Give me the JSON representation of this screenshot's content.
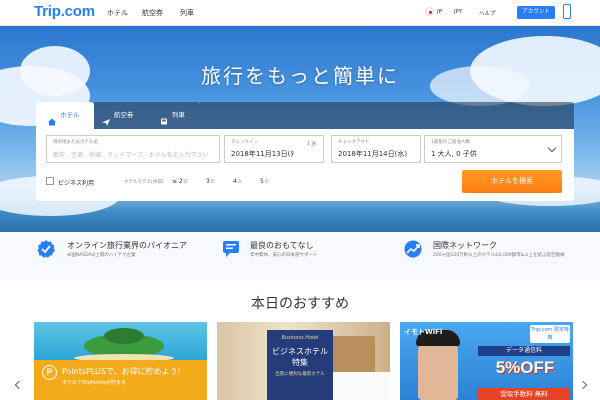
{
  "header": {
    "logo": "Trip.com",
    "nav": [
      "ホテル",
      "航空券",
      "列車"
    ],
    "lang": "JP",
    "currency": "JPY",
    "help": "ヘルプ",
    "account_button": "アカウント"
  },
  "hero": {
    "headline": "旅行をもっと簡単に"
  },
  "search": {
    "tabs": [
      "ホテル",
      "航空券",
      "列車"
    ],
    "destination": {
      "label": "目的地またはホテル名",
      "placeholder": "都市、空港、地域、ランドマーク、ホテル名を入力下さい"
    },
    "checkin": {
      "label": "チェックイン",
      "value": "2018年11月13日(ﾀ"
    },
    "nights": "1 泊",
    "checkout": {
      "label": "チェックアウト",
      "value": "2018年11月14日(水)"
    },
    "guests": {
      "label": "1部屋のご宿泊人数",
      "value": "1 大人, 0 子供"
    },
    "business_label": "ビジネス利用",
    "stars_label": "ホテルクラス(評価)",
    "star_options": [
      "≤ 2☆",
      "3☆",
      "4☆",
      "5☆"
    ],
    "search_button": "ホテルを検索"
  },
  "features": [
    {
      "icon": "badge-check-icon",
      "title": "オンライン旅行業界のパイオニア",
      "desc": "米国NASDAQ上場のハイテク企業"
    },
    {
      "icon": "chat-icon",
      "title": "最良のおもてなし",
      "desc": "年中無休、安心の日本語サポート"
    },
    {
      "icon": "growth-chart-icon",
      "title": "国際ネットワーク",
      "desc": "200ヶ国120万軒以上のホテル&5,000都市&以上を結ぶ航空路線"
    }
  ],
  "recommend": {
    "title": "本日のおすすめ",
    "cards": [
      {
        "title": "PointsPLUSで、お得に貯めよう!",
        "sub": "ホテルでTripPointsが貯まる"
      },
      {
        "title": "ビジネスホテル特集",
        "tag": "Business Hotel",
        "sub": "出張に便利な最新ホテル"
      },
      {
        "brand": "イモトWiFi",
        "badge": "Trip.com 限定特典",
        "line1": "データ通信料",
        "line2": "5%OFF",
        "line3": "受取手数料 無料"
      }
    ]
  },
  "colors": {
    "brand": "#287dfa",
    "accent": "#ff8619"
  }
}
